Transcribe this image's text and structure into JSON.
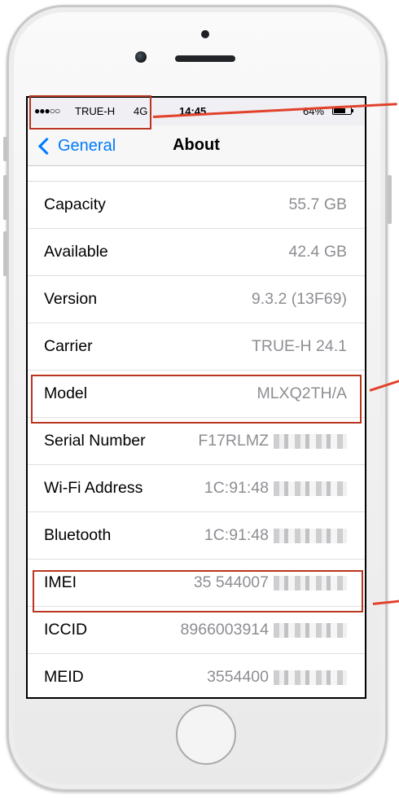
{
  "statusbar": {
    "signal": "●●●○○",
    "carrier": "TRUE-H",
    "network": "4G",
    "time": "14:45",
    "battery_percent": "64%",
    "battery_level": 0.64
  },
  "navbar": {
    "back_label": "General",
    "title": "About"
  },
  "rows": [
    {
      "label": "Capacity",
      "value": "55.7 GB"
    },
    {
      "label": "Available",
      "value": "42.4 GB"
    },
    {
      "label": "Version",
      "value": "9.3.2 (13F69)"
    },
    {
      "label": "Carrier",
      "value": "TRUE-H 24.1"
    },
    {
      "label": "Model",
      "value": "MLXQ2TH/A"
    },
    {
      "label": "Serial Number",
      "value": "F17RLMZ"
    },
    {
      "label": "Wi-Fi Address",
      "value": "1C:91:48"
    },
    {
      "label": "Bluetooth",
      "value": "1C:91:48"
    },
    {
      "label": "IMEI",
      "value": "35 544007"
    },
    {
      "label": "ICCID",
      "value": "8966003914"
    },
    {
      "label": "MEID",
      "value": "3554400"
    }
  ],
  "colors": {
    "accent": "#007aff",
    "annotation": "#b9351f"
  }
}
